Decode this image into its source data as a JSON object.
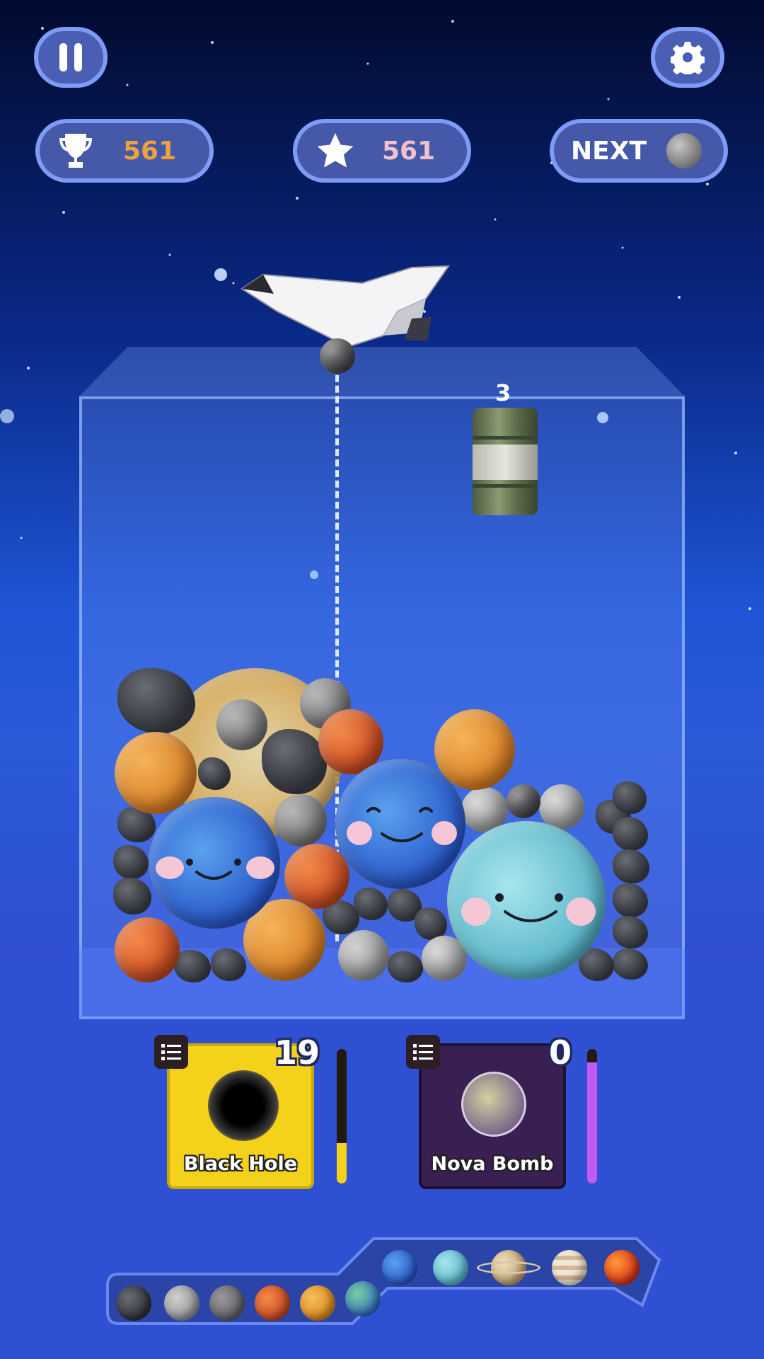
{
  "hud": {
    "pause_icon": "pause-icon",
    "settings_icon": "gear-icon",
    "best_score": "561",
    "score": "561",
    "next_label": "NEXT",
    "next_item": "moon",
    "colors": {
      "best": "#f0a23a",
      "score": "#f2c2c8"
    }
  },
  "playfield": {
    "drop_countdown": "3",
    "held_item": "moon",
    "falling_object": "barrel"
  },
  "powerups": [
    {
      "label": "Black Hole",
      "count": "19",
      "icon": "black-hole-icon",
      "meter_fraction": 0.3,
      "color": "#f4d21c"
    },
    {
      "label": "Nova Bomb",
      "count": "0",
      "icon": "nova-bomb-icon",
      "meter_fraction": 0.9,
      "color": "#c05cf0"
    }
  ],
  "evolution_track": [
    "asteroid",
    "moon",
    "mercury",
    "mars",
    "venus",
    "earth",
    "neptune",
    "uranus",
    "saturn",
    "jupiter",
    "sun"
  ]
}
